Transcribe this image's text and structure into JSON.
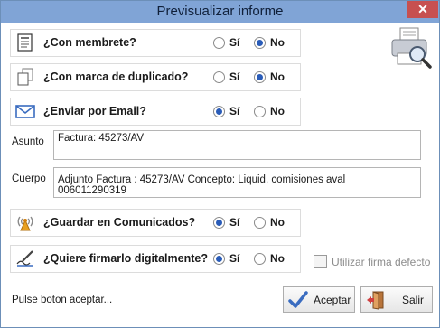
{
  "window": {
    "title": "Previsualizar informe",
    "close_glyph": "✕"
  },
  "options": [
    {
      "label": "¿Con membrete?",
      "icon": "letterhead-icon",
      "yes": "Sí",
      "no": "No",
      "selected": "no"
    },
    {
      "label": "¿Con marca de duplicado?",
      "icon": "duplicate-pages-icon",
      "yes": "Sí",
      "no": "No",
      "selected": "no"
    },
    {
      "label": "¿Enviar por Email?",
      "icon": "envelope-icon",
      "yes": "Sí",
      "no": "No",
      "selected": "yes"
    },
    {
      "label": "¿Guardar en Comunicados?",
      "icon": "broadcast-icon",
      "yes": "Sí",
      "no": "No",
      "selected": "yes"
    },
    {
      "label": "¿Quiere firmarlo digitalmente?",
      "icon": "signature-pen-icon",
      "yes": "Sí",
      "no": "No",
      "selected": "yes"
    }
  ],
  "fields": {
    "asunto_label": "Asunto",
    "asunto_value": "Factura: 45273/AV",
    "cuerpo_label": "Cuerpo",
    "cuerpo_value": "Adjunto Factura : 45273/AV  Concepto: Liquid. comisiones aval 006011290319"
  },
  "checkbox": {
    "label": "Utilizar firma defecto",
    "checked": false
  },
  "status_text": "Pulse boton aceptar...",
  "buttons": {
    "accept": "Aceptar",
    "exit": "Salir"
  },
  "colors": {
    "title_bar": "#80a4d6",
    "close_button": "#c75050",
    "radio_selected": "#2a5cb8",
    "accent_blue": "#3a6cc0"
  }
}
